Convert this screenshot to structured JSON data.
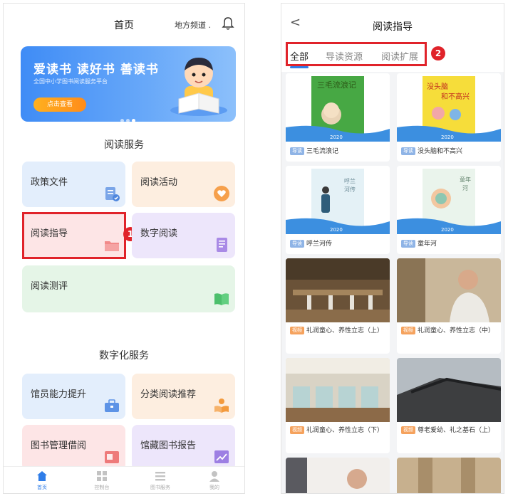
{
  "left": {
    "header": {
      "title": "首页",
      "region": "地方频道 ."
    },
    "banner": {
      "slogan": "爱读书 读好书 善读书",
      "subtitle": "全国中小学图书阅读服务平台",
      "cta": "点击查看"
    },
    "sections": [
      {
        "title": "阅读服务"
      },
      {
        "title": "数字化服务"
      }
    ],
    "reading_services": [
      {
        "label": "政策文件",
        "icon": "document-icon"
      },
      {
        "label": "阅读活动",
        "icon": "heart-icon"
      },
      {
        "label": "阅读指导",
        "icon": "folder-icon"
      },
      {
        "label": "数字阅读",
        "icon": "tablet-icon"
      },
      {
        "label": "阅读测评",
        "icon": "book-icon"
      }
    ],
    "digital_services": [
      {
        "label": "馆员能力提升",
        "icon": "briefcase-icon"
      },
      {
        "label": "分类阅读推荐",
        "icon": "reader-icon"
      },
      {
        "label": "图书管理借阅",
        "icon": "library-card-icon"
      },
      {
        "label": "馆藏图书报告",
        "icon": "chart-icon"
      }
    ],
    "callout": "1",
    "tabbar": [
      {
        "label": "首页",
        "icon": "home-icon",
        "active": true
      },
      {
        "label": "控制台",
        "icon": "grid-icon",
        "active": false
      },
      {
        "label": "图书服务",
        "icon": "list-icon",
        "active": false
      },
      {
        "label": "我的",
        "icon": "user-icon",
        "active": false
      }
    ]
  },
  "right": {
    "header": {
      "back": "<",
      "title": "阅读指导"
    },
    "tabs": [
      {
        "label": "全部",
        "active": true
      },
      {
        "label": "导读资源",
        "active": false
      },
      {
        "label": "阅读扩展",
        "active": false
      }
    ],
    "callout": "2",
    "cover_year": "2020",
    "items": [
      {
        "tag": "导读",
        "title": "三毛流浪记"
      },
      {
        "tag": "导读",
        "title": "没头脑和不高兴"
      },
      {
        "tag": "导读",
        "title": "呼兰河传"
      },
      {
        "tag": "导读",
        "title": "童年河"
      },
      {
        "tag": "视频",
        "title": "礼润童心、养性立志（上）"
      },
      {
        "tag": "视频",
        "title": "礼润童心、养性立志（中）"
      },
      {
        "tag": "视频",
        "title": "礼润童心、养性立志（下）"
      },
      {
        "tag": "视频",
        "title": "尊老爱幼、礼之基石（上）"
      }
    ]
  },
  "colors": {
    "accent": "#2f7de8",
    "highlight": "#e0232a",
    "tag_guide": "#8fb4e6",
    "tag_video": "#f5a25d"
  }
}
